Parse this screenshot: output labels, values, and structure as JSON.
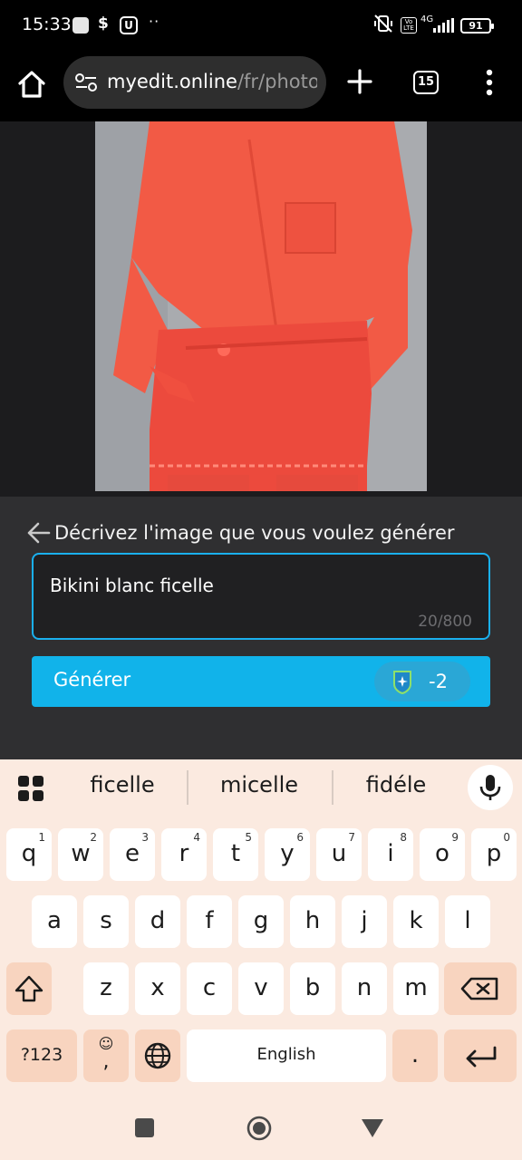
{
  "status_bar": {
    "time": "15:33",
    "dollar_glyph": "$",
    "u_glyph": "U",
    "dots": "··",
    "lte_label": "Vo LTE",
    "network": "4G",
    "battery": "91"
  },
  "toolbar": {
    "url_host": "myedit.online",
    "url_path": "/fr/photo",
    "tab_count": "15"
  },
  "prompt": {
    "title": "Décrivez l'image que vous voulez générer",
    "value": "Bikini blanc ficelle",
    "counter": "20/800"
  },
  "generate": {
    "label": "Générer",
    "cost": "-2"
  },
  "keyboard": {
    "suggestions": [
      "ficelle",
      "micelle",
      "fidéle"
    ],
    "row1": [
      {
        "k": "q",
        "n": "1"
      },
      {
        "k": "w",
        "n": "2"
      },
      {
        "k": "e",
        "n": "3"
      },
      {
        "k": "r",
        "n": "4"
      },
      {
        "k": "t",
        "n": "5"
      },
      {
        "k": "y",
        "n": "6"
      },
      {
        "k": "u",
        "n": "7"
      },
      {
        "k": "i",
        "n": "8"
      },
      {
        "k": "o",
        "n": "9"
      },
      {
        "k": "p",
        "n": "0"
      }
    ],
    "row2": [
      "a",
      "s",
      "d",
      "f",
      "g",
      "h",
      "j",
      "k",
      "l"
    ],
    "row3": [
      "z",
      "x",
      "c",
      "v",
      "b",
      "n",
      "m"
    ],
    "numbers_key": "?123",
    "emoji_key": "☺",
    "comma_key": ",",
    "space_label": "English",
    "period_key": "."
  },
  "colors": {
    "accent": "#11b3ea",
    "panel": "#2f2f31",
    "keyboard_bg": "#fbeae0",
    "modifier_key": "#f8d4bf",
    "mask_red": "#f24a3c"
  }
}
